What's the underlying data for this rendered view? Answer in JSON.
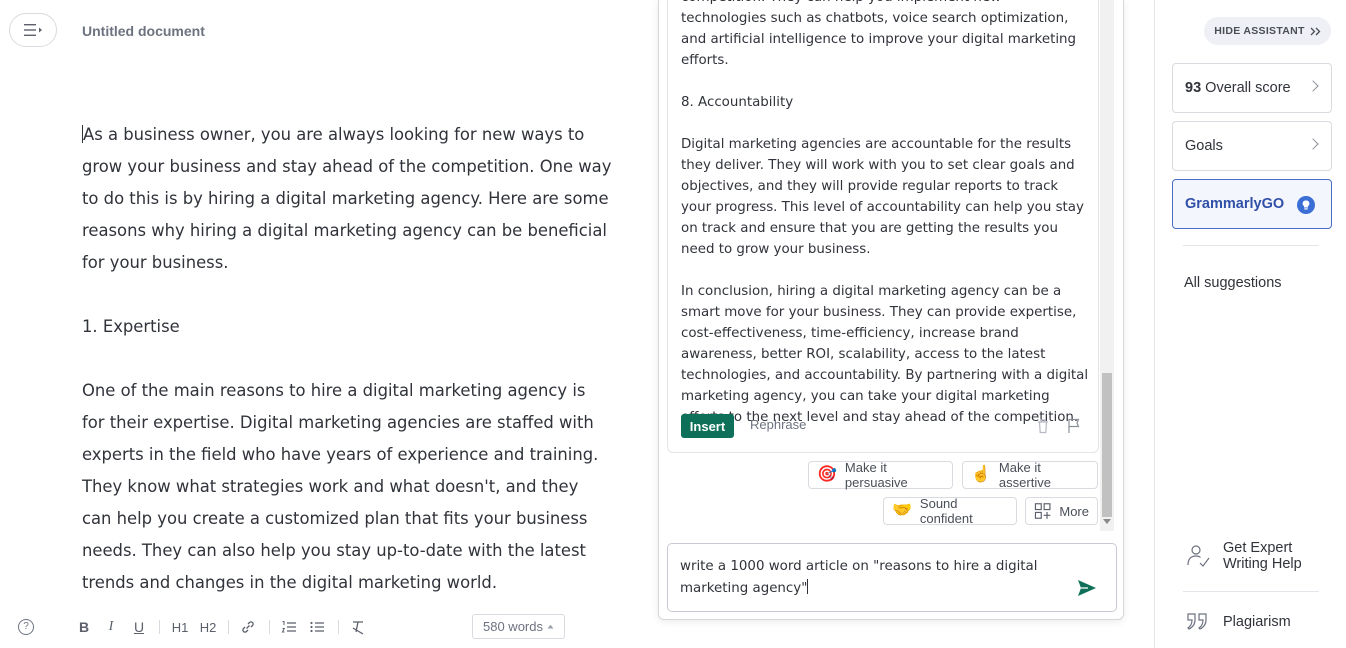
{
  "document": {
    "title": "Untitled document",
    "paragraphs": [
      "As a business owner, you are always looking for new ways to grow your business and stay ahead of the competition. One way to do this is by hiring a digital marketing agency. Here are some reasons why hiring a digital marketing agency can be beneficial for your business.",
      "1. Expertise",
      "One of the main reasons to hire a digital marketing agency is for their expertise. Digital marketing agencies are staffed with experts in the field who have years of experience and training. They know what strategies work and what doesn't, and they can help you create a customized plan that fits your business needs. They can also help you stay up-to-date with the latest trends and changes in the digital marketing world."
    ]
  },
  "toolbar": {
    "help": "?",
    "bold": "B",
    "italic": "I",
    "underline": "U",
    "h1": "H1",
    "h2": "H2",
    "word_count": "580 words"
  },
  "grammarly_go": {
    "answer_paragraphs": [
      "competition. They can help you implement new technologies such as chatbots, voice search optimization, and artificial intelligence to improve your digital marketing efforts.",
      "8. Accountability",
      "Digital marketing agencies are accountable for the results they deliver. They will work with you to set clear goals and objectives, and they will provide regular reports to track your progress. This level of accountability can help you stay on track and ensure that you are getting the results you need to grow your business.",
      "In conclusion, hiring a digital marketing agency can be a smart move for your business. They can provide expertise, cost-effectiveness, time-efficiency, increase brand awareness, better ROI, scalability, access to the latest technologies, and accountability. By partnering with a digital marketing agency, you can take your digital marketing efforts to the next level and stay ahead of the competition."
    ],
    "insert_label": "Insert",
    "rephrase_label": "Rephrase",
    "chips": {
      "persuasive": "Make it persuasive",
      "assertive": "Make it assertive",
      "confident": "Sound confident",
      "more": "More"
    },
    "prompt_value": "write a 1000 word article on \"reasons to hire a digital marketing agency\""
  },
  "sidebar": {
    "hide_assistant": "HIDE ASSISTANT",
    "overall_score_value": "93",
    "overall_score_label": "Overall score",
    "goals": "Goals",
    "grammarly_go": "GrammarlyGO",
    "all_suggestions": "All suggestions",
    "expert_help": "Get Expert Writing Help",
    "plagiarism": "Plagiarism"
  },
  "colors": {
    "insert_green": "#0e7058",
    "go_blue": "#3b6fd6",
    "send_green": "#0e7058"
  }
}
